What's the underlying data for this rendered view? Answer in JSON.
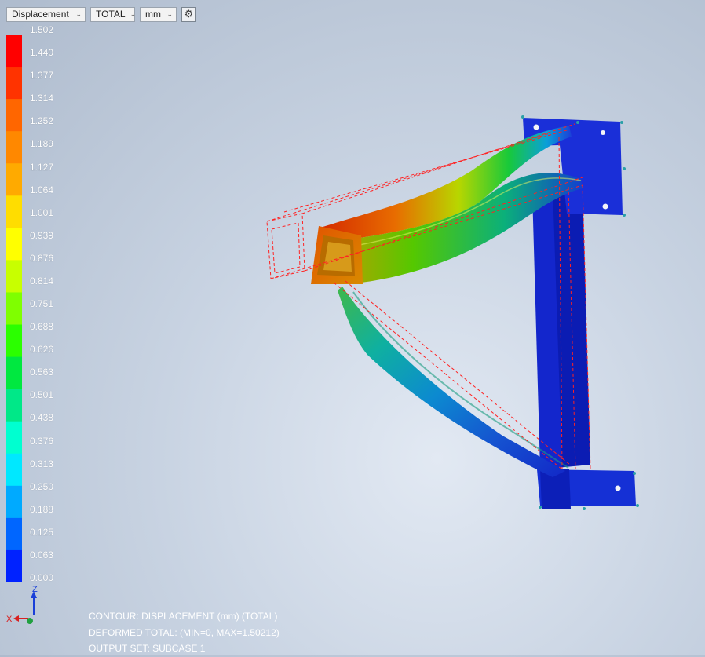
{
  "toolbar": {
    "result_type": "Displacement",
    "component": "TOTAL",
    "units": "mm",
    "settings_icon": "gear-icon"
  },
  "legend": {
    "values": [
      "1.502",
      "1.440",
      "1.377",
      "1.314",
      "1.252",
      "1.189",
      "1.127",
      "1.064",
      "1.001",
      "0.939",
      "0.876",
      "0.814",
      "0.751",
      "0.688",
      "0.626",
      "0.563",
      "0.501",
      "0.438",
      "0.376",
      "0.313",
      "0.250",
      "0.188",
      "0.125",
      "0.063",
      "0.000"
    ],
    "colors": [
      "#ff0000",
      "#ff3300",
      "#ff6600",
      "#ff8800",
      "#ffaa00",
      "#ffdd00",
      "#ffff00",
      "#c8ff00",
      "#7fff00",
      "#2bff00",
      "#00e840",
      "#00e888",
      "#00ffd0",
      "#00e8ff",
      "#00aaff",
      "#0066ff",
      "#0022ff"
    ]
  },
  "triad": {
    "z": "Z",
    "x": "X"
  },
  "info": {
    "line1": "CONTOUR: DISPLACEMENT (mm) (TOTAL)",
    "line2": "DEFORMED TOTAL: (MIN=0, MAX=1.50212)",
    "line3": "OUTPUT SET: SUBCASE 1"
  }
}
